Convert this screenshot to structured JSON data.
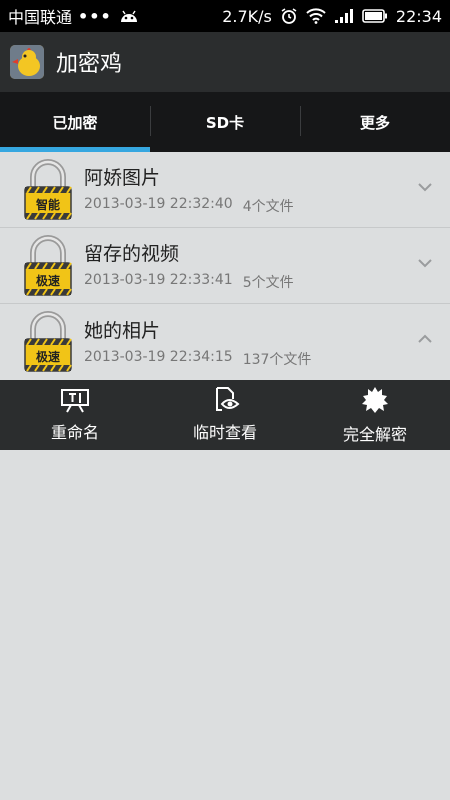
{
  "status_bar": {
    "carrier": "中国联通",
    "dots": "•••",
    "speed": "2.7K/s",
    "time": "22:34"
  },
  "app": {
    "title": "加密鸡"
  },
  "tabs": [
    {
      "label": "已加密",
      "active": true
    },
    {
      "label": "SD卡",
      "active": false
    },
    {
      "label": "更多",
      "active": false
    }
  ],
  "items": [
    {
      "title": "阿娇图片",
      "date": "2013-03-19 22:32:40",
      "count": "4个文件",
      "lock_label": "智能",
      "expanded": false
    },
    {
      "title": "留存的视频",
      "date": "2013-03-19 22:33:41",
      "count": "5个文件",
      "lock_label": "极速",
      "expanded": false
    },
    {
      "title": "她的相片",
      "date": "2013-03-19 22:34:15",
      "count": "137个文件",
      "lock_label": "极速",
      "expanded": true
    }
  ],
  "actions": [
    {
      "label": "重命名",
      "icon": "rename-icon"
    },
    {
      "label": "临时查看",
      "icon": "temp-view-icon"
    },
    {
      "label": "完全解密",
      "icon": "decrypt-icon"
    }
  ],
  "colors": {
    "tab_indicator": "#36a7e0",
    "app_bar": "#2b2d2e",
    "tabs_bg": "#161718",
    "list_bg": "#dcdedf"
  }
}
